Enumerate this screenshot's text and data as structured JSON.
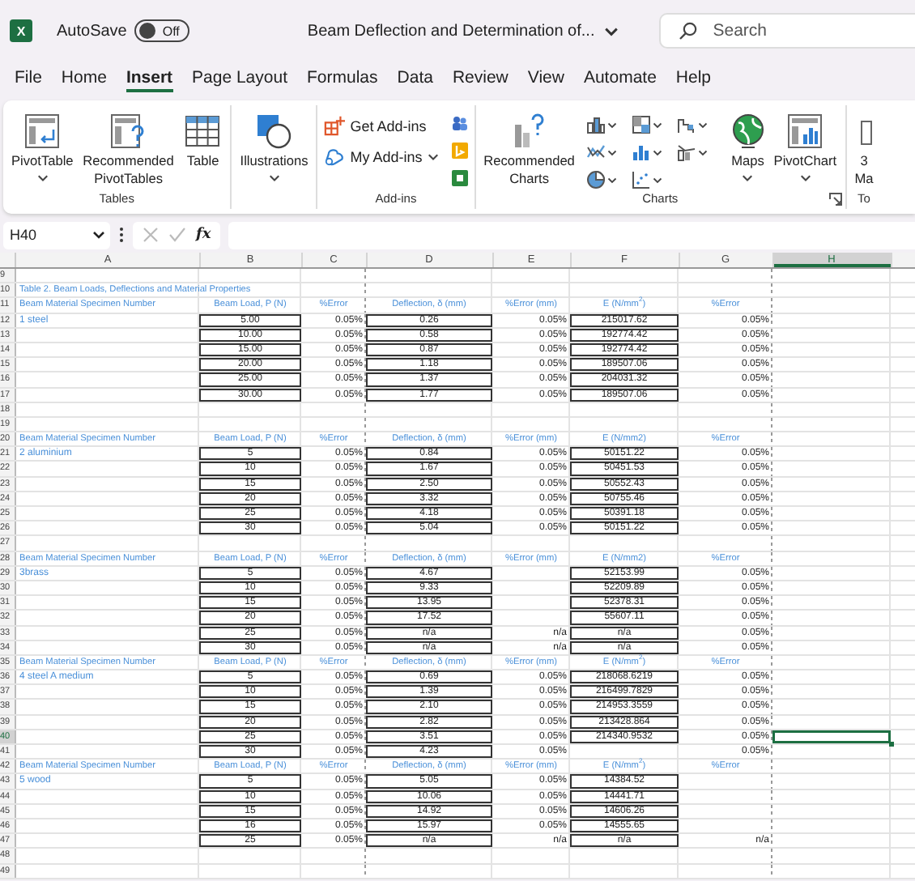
{
  "title_bar": {
    "logo_letter": "X",
    "autosave_label": "AutoSave",
    "autosave_on": false,
    "toggle_text": "Off",
    "document_title": "Beam Deflection and Determination of...",
    "search_placeholder": "Search"
  },
  "menu_tabs": [
    {
      "label": "File",
      "selected": false
    },
    {
      "label": "Home",
      "selected": false
    },
    {
      "label": "Insert",
      "selected": true
    },
    {
      "label": "Page Layout",
      "selected": false
    },
    {
      "label": "Formulas",
      "selected": false
    },
    {
      "label": "Data",
      "selected": false
    },
    {
      "label": "Review",
      "selected": false
    },
    {
      "label": "View",
      "selected": false
    },
    {
      "label": "Automate",
      "selected": false
    },
    {
      "label": "Help",
      "selected": false
    }
  ],
  "ribbon": {
    "groups": [
      {
        "label": "Tables",
        "items": [
          {
            "label": "PivotTable",
            "dropdown": true
          },
          {
            "label": "Recommended PivotTables",
            "dropdown": false
          },
          {
            "label": "Table",
            "dropdown": false
          }
        ]
      },
      {
        "items": [
          {
            "label": "Illustrations",
            "dropdown": true
          }
        ]
      },
      {
        "label": "Add-ins",
        "items": [
          {
            "label": "Get Add-ins",
            "dropdown": false
          },
          {
            "label": "My Add-ins",
            "dropdown": true
          }
        ]
      },
      {
        "label": "Charts",
        "items": [
          {
            "label": "Recommended Charts",
            "dropdown": false
          },
          {
            "label": "Maps",
            "dropdown": true
          },
          {
            "label": "PivotChart",
            "dropdown": true
          }
        ],
        "chart_buttons": [
          {
            "dropdown": true
          },
          {
            "dropdown": true
          },
          {
            "dropdown": true
          },
          {
            "dropdown": true
          },
          {
            "dropdown": true
          },
          {
            "dropdown": true
          },
          {
            "dropdown": true
          },
          {
            "dropdown": true
          }
        ]
      },
      {
        "label": "To",
        "items": [
          {
            "label": "3 Ma",
            "dropdown": false
          }
        ]
      }
    ]
  },
  "formula_bar": {
    "name_box": "H40",
    "fx": "fx"
  },
  "columns": [
    {
      "label": "A",
      "selected": false
    },
    {
      "label": "B",
      "selected": false
    },
    {
      "label": "C",
      "selected": false
    },
    {
      "label": "D",
      "selected": false
    },
    {
      "label": "E",
      "selected": false
    },
    {
      "label": "F",
      "selected": false
    },
    {
      "label": "G",
      "selected": false
    },
    {
      "label": "H",
      "selected": true
    }
  ],
  "rows": [
    {
      "row": "9",
      "kind": "blank",
      "selected": false
    },
    {
      "row": "10",
      "kind": "title",
      "selected": false,
      "cells": [
        "Table 2. Beam Loads, Deflections and Material Properties"
      ]
    },
    {
      "row": "11",
      "kind": "header",
      "selected": false,
      "cells": [
        "Beam Material Specimen Number",
        "Beam Load, P (N)",
        "%Error",
        "Deflection, δ (mm)",
        "%Error (mm)",
        "E (N/mm$^{2}$)",
        "%Error"
      ]
    },
    {
      "row": "12",
      "kind": "data",
      "selected": false,
      "cells": [
        "1 steel",
        "5.00",
        "0.05%",
        "0.26",
        "0.05%",
        "215017.62",
        "0.05%"
      ]
    },
    {
      "row": "13",
      "kind": "data",
      "selected": false,
      "cells": [
        "",
        "10.00",
        "0.05%",
        "0.58",
        "0.05%",
        "192774.42",
        "0.05%"
      ]
    },
    {
      "row": "14",
      "kind": "data",
      "selected": false,
      "cells": [
        "",
        "15.00",
        "0.05%",
        "0.87",
        "0.05%",
        "192774.42",
        "0.05%"
      ]
    },
    {
      "row": "15",
      "kind": "data",
      "selected": false,
      "cells": [
        "",
        "20.00",
        "0.05%",
        "1.18",
        "0.05%",
        "189507.06",
        "0.05%"
      ]
    },
    {
      "row": "16",
      "kind": "data",
      "selected": false,
      "cells": [
        "",
        "25.00",
        "0.05%",
        "1.37",
        "0.05%",
        "204031.32",
        "0.05%"
      ]
    },
    {
      "row": "17",
      "kind": "data",
      "selected": false,
      "cells": [
        "",
        "30.00",
        "0.05%",
        "1.77",
        "0.05%",
        "189507.06",
        "0.05%"
      ]
    },
    {
      "row": "18",
      "kind": "blank",
      "selected": false
    },
    {
      "row": "19",
      "kind": "blank",
      "selected": false
    },
    {
      "row": "20",
      "kind": "header",
      "selected": false,
      "cells": [
        "Beam Material Specimen Number",
        "Beam Load, P (N)",
        "%Error",
        "Deflection, δ (mm)",
        "%Error (mm)",
        "E (N/mm2)",
        "%Error"
      ]
    },
    {
      "row": "21",
      "kind": "data",
      "selected": false,
      "cells": [
        "2 aluminium",
        "5",
        "0.05%",
        "0.84",
        "0.05%",
        "50151.22",
        "0.05%"
      ]
    },
    {
      "row": "22",
      "kind": "data",
      "selected": false,
      "cells": [
        "",
        "10",
        "0.05%",
        "1.67",
        "0.05%",
        "50451.53",
        "0.05%"
      ]
    },
    {
      "row": "23",
      "kind": "data",
      "selected": false,
      "cells": [
        "",
        "15",
        "0.05%",
        "2.50",
        "0.05%",
        "50552.43",
        "0.05%"
      ]
    },
    {
      "row": "24",
      "kind": "data",
      "selected": false,
      "cells": [
        "",
        "20",
        "0.05%",
        "3.32",
        "0.05%",
        "50755.46",
        "0.05%"
      ]
    },
    {
      "row": "25",
      "kind": "data",
      "selected": false,
      "cells": [
        "",
        "25",
        "0.05%",
        "4.18",
        "0.05%",
        "50391.18",
        "0.05%"
      ]
    },
    {
      "row": "26",
      "kind": "data",
      "selected": false,
      "cells": [
        "",
        "30",
        "0.05%",
        "5.04",
        "0.05%",
        "50151.22",
        "0.05%"
      ]
    },
    {
      "row": "27",
      "kind": "blank",
      "selected": false
    },
    {
      "row": "28",
      "kind": "header",
      "selected": false,
      "cells": [
        "Beam Material Specimen Number",
        "Beam Load, P (N)",
        "%Error",
        "Deflection, δ (mm)",
        "%Error (mm)",
        "E (N/mm2)",
        "%Error"
      ]
    },
    {
      "row": "29",
      "kind": "data",
      "selected": false,
      "cells": [
        "3brass",
        "5",
        "0.05%",
        "4.67",
        "",
        "52153.99",
        "0.05%"
      ]
    },
    {
      "row": "30",
      "kind": "data",
      "selected": false,
      "cells": [
        "",
        "10",
        "0.05%",
        "9.33",
        "",
        "52209.89",
        "0.05%"
      ]
    },
    {
      "row": "31",
      "kind": "data",
      "selected": false,
      "cells": [
        "",
        "15",
        "0.05%",
        "13.95",
        "",
        "52378.31",
        "0.05%"
      ]
    },
    {
      "row": "32",
      "kind": "data",
      "selected": false,
      "cells": [
        "",
        "20",
        "0.05%",
        "17.52",
        "",
        "55607.11",
        "0.05%"
      ]
    },
    {
      "row": "33",
      "kind": "data",
      "selected": false,
      "cells": [
        "",
        "25",
        "0.05%",
        "n/a",
        "n/a",
        "n/a",
        "0.05%"
      ]
    },
    {
      "row": "34",
      "kind": "data",
      "selected": false,
      "cells": [
        "",
        "30",
        "0.05%",
        "n/a",
        "n/a",
        "n/a",
        "0.05%"
      ]
    },
    {
      "row": "35",
      "kind": "header",
      "selected": false,
      "cells": [
        "Beam Material Specimen Number",
        "Beam Load, P (N)",
        "%Error",
        "Deflection, δ (mm)",
        "%Error (mm)",
        "E (N/mm$^{2}$)",
        "%Error"
      ]
    },
    {
      "row": "36",
      "kind": "data",
      "selected": false,
      "cells": [
        "4 steel A medium",
        "5",
        "0.05%",
        "0.69",
        "0.05%",
        "218068.6219",
        "0.05%"
      ]
    },
    {
      "row": "37",
      "kind": "data",
      "selected": false,
      "cells": [
        "",
        "10",
        "0.05%",
        "1.39",
        "0.05%",
        "216499.7829",
        "0.05%"
      ]
    },
    {
      "row": "38",
      "kind": "data",
      "selected": false,
      "cells": [
        "",
        "15",
        "0.05%",
        "2.10",
        "0.05%",
        "214953.3559",
        "0.05%"
      ]
    },
    {
      "row": "39",
      "kind": "data",
      "selected": false,
      "cells": [
        "",
        "20",
        "0.05%",
        "2.82",
        "0.05%",
        "213428.864",
        "0.05%"
      ]
    },
    {
      "row": "40",
      "kind": "data",
      "selected": true,
      "cells": [
        "",
        "25",
        "0.05%",
        "3.51",
        "0.05%",
        "214340.9532",
        "0.05%"
      ]
    },
    {
      "row": "41",
      "kind": "data",
      "selected": false,
      "cells": [
        "",
        "30",
        "0.05%",
        "4.23",
        "0.05%",
        "",
        "0.05%"
      ]
    },
    {
      "row": "42",
      "kind": "header",
      "selected": false,
      "cells": [
        "Beam Material Specimen Number",
        "Beam Load, P (N)",
        "%Error",
        "Deflection, δ (mm)",
        "%Error (mm)",
        "E (N/mm$^{2}$)",
        "%Error"
      ]
    },
    {
      "row": "43",
      "kind": "data",
      "selected": false,
      "cells": [
        "5 wood",
        "5",
        "0.05%",
        "5.05",
        "0.05%",
        "14384.52",
        ""
      ]
    },
    {
      "row": "44",
      "kind": "data",
      "selected": false,
      "cells": [
        "",
        "10",
        "0.05%",
        "10.06",
        "0.05%",
        "14441.71",
        ""
      ]
    },
    {
      "row": "45",
      "kind": "data",
      "selected": false,
      "cells": [
        "",
        "15",
        "0.05%",
        "14.92",
        "0.05%",
        "14606.26",
        ""
      ]
    },
    {
      "row": "46",
      "kind": "data",
      "selected": false,
      "cells": [
        "",
        "16",
        "0.05%",
        "15.97",
        "0.05%",
        "14555.65",
        ""
      ]
    },
    {
      "row": "47",
      "kind": "data",
      "selected": false,
      "cells": [
        "",
        "25",
        "0.05%",
        "n/a",
        "n/a",
        "n/a",
        "n/a"
      ]
    },
    {
      "row": "48",
      "kind": "blank",
      "selected": false
    },
    {
      "row": "49",
      "kind": "blank",
      "selected": false
    }
  ]
}
